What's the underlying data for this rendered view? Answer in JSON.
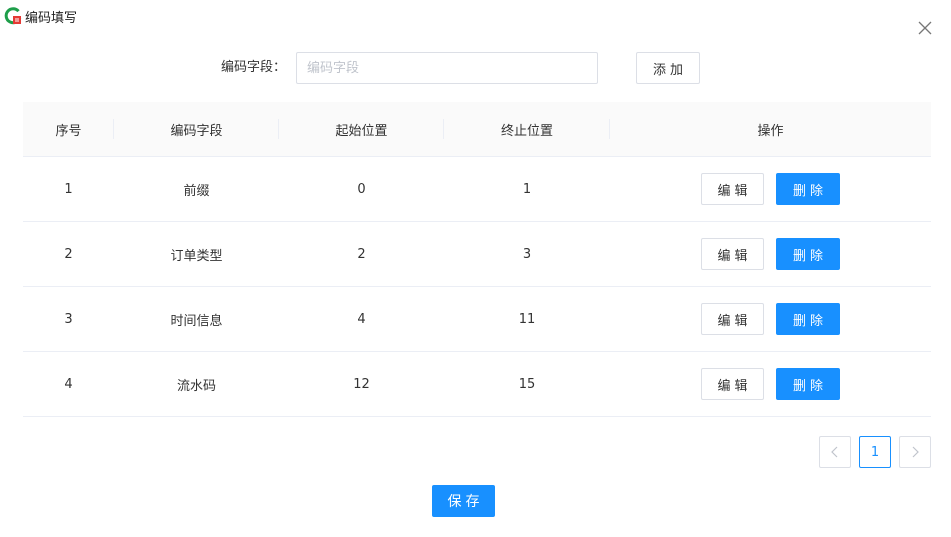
{
  "window": {
    "title": "编码填写",
    "logo_icon": "app-logo-icon",
    "close_icon": "close-icon"
  },
  "form": {
    "label": "编码字段：",
    "input_value": "",
    "input_placeholder": "编码字段",
    "add_label": "添加"
  },
  "table": {
    "headers": [
      "序号",
      "编码字段",
      "起始位置",
      "终止位置",
      "操作"
    ],
    "rows": [
      {
        "index": "1",
        "field": "前缀",
        "start": "0",
        "end": "1",
        "edit": "编辑",
        "delete": "删除"
      },
      {
        "index": "2",
        "field": "订单类型",
        "start": "2",
        "end": "3",
        "edit": "编辑",
        "delete": "删除"
      },
      {
        "index": "3",
        "field": "时间信息",
        "start": "4",
        "end": "11",
        "edit": "编辑",
        "delete": "删除"
      },
      {
        "index": "4",
        "field": "流水码",
        "start": "12",
        "end": "15",
        "edit": "编辑",
        "delete": "删除"
      }
    ]
  },
  "pagination": {
    "prev_icon": "chevron-left-icon",
    "current_page": "1",
    "next_icon": "chevron-right-icon"
  },
  "footer": {
    "save_label": "保存"
  },
  "colors": {
    "primary": "#1890ff",
    "border": "#dcdfe6",
    "header_bg": "#fafafa",
    "logo_green": "#1e9e4a",
    "logo_red": "#e53935"
  }
}
